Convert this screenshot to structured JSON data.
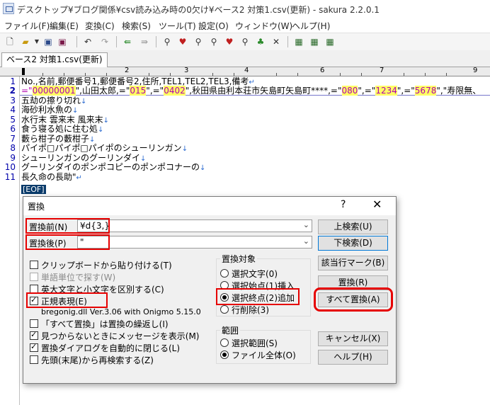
{
  "window": {
    "title": "デスクトップ¥ブログ関係¥csv読み込み時の0欠け¥ベース2 対策1.csv(更新) - sakura 2.2.0.1"
  },
  "menu": [
    "ファイル(F)",
    "編集(E)",
    "変換(C)",
    "検索(S)",
    "ツール(T)",
    "設定(O)",
    "ウィンドウ(W)",
    "ヘルプ(H)"
  ],
  "toolbar_icons": [
    "new-file",
    "open-folder",
    "dropdown",
    "save",
    "save-all",
    "undo",
    "redo",
    "jump-back",
    "jump-forward",
    "search-down",
    "search-up",
    "search-next",
    "search-prev",
    "grep",
    "bookmark",
    "bookmark-next",
    "bookmark-prev",
    "bookmark-clear",
    "tile",
    "tile-vertical",
    "tile-horizontal"
  ],
  "tab": {
    "label": "ベース2 対策1.csv(更新)"
  },
  "ruler": [
    "1",
    "2",
    "3",
    "4",
    "5",
    "6",
    "7",
    "8",
    "9"
  ],
  "editor": {
    "line_numbers": [
      "1",
      "2",
      "3",
      "4",
      "5",
      "6",
      "7",
      "8",
      "9",
      "10",
      "11"
    ],
    "line1": "No.,名前,郵便番号1,郵便番号2,住所,TEL1,TEL2,TEL3,備考",
    "line2": {
      "p0": "=\"",
      "h1": "00000001",
      "p1": "\",山田太郎,=\"",
      "h2": "015",
      "p2": "\",=\"",
      "h3": "0402",
      "p3": "\",秋田県由利本荘市矢島町矢島町****,=\"",
      "h4": "080",
      "p4": "\",=\"",
      "h5": "1234",
      "p5": "\",=\"",
      "h6": "5678",
      "p6": "\",\"寿限無、"
    },
    "lines": [
      "五劫の擦り切れ",
      "海砂利水魚の",
      "水行末 雲来末 風来末",
      "食う寝る処に住む処",
      "藪ら柑子の藪柑子",
      "パイポ□パイポ□パイポのシューリンガン",
      "シューリンガンのグーリンダイ",
      "グーリンダイのポンポコピーのポンポコナーの",
      "長久命の長助\""
    ],
    "eof": "[EOF]"
  },
  "dialog": {
    "title": "置換",
    "help_glyph": "?",
    "close_glyph": "✕",
    "find_label": "置換前(N)",
    "find_value": "¥d{3,}",
    "replace_label": "置換後(P)",
    "replace_value": "\"",
    "options": [
      {
        "label": "クリップボードから貼り付ける(T)",
        "checked": false,
        "enabled": true
      },
      {
        "label": "単語単位で探す(W)",
        "checked": false,
        "enabled": false
      },
      {
        "label": "英大文字と小文字を区別する(C)",
        "checked": false,
        "enabled": true
      },
      {
        "label": "正規表現(E)",
        "checked": true,
        "enabled": true
      },
      {
        "label": "「すべて置換」は置換の繰返し(I)",
        "checked": false,
        "enabled": true
      },
      {
        "label": "見つからないときにメッセージを表示(M)",
        "checked": true,
        "enabled": true
      },
      {
        "label": "置換ダイアログを自動的に閉じる(L)",
        "checked": true,
        "enabled": true
      },
      {
        "label": "先頭(末尾)から再検索する(Z)",
        "checked": false,
        "enabled": true
      }
    ],
    "regex_lib": "bregonig.dll Ver.3.06 with Onigmo 5.15.0",
    "target_group": "置換対象",
    "targets": [
      "選択文字(0)",
      "選択始点(1)挿入",
      "選択終点(2)追加",
      "行削除(3)"
    ],
    "target_selected": 2,
    "range_group": "範囲",
    "ranges": [
      "選択範囲(S)",
      "ファイル全体(O)"
    ],
    "range_selected": 1,
    "buttons": {
      "search_up": "上検索(U)",
      "search_down": "下検索(D)",
      "mark_all": "該当行マーク(B)",
      "replace": "置換(R)",
      "replace_all": "すべて置換(A)",
      "cancel": "キャンセル(X)",
      "help": "ヘルプ(H)"
    }
  }
}
